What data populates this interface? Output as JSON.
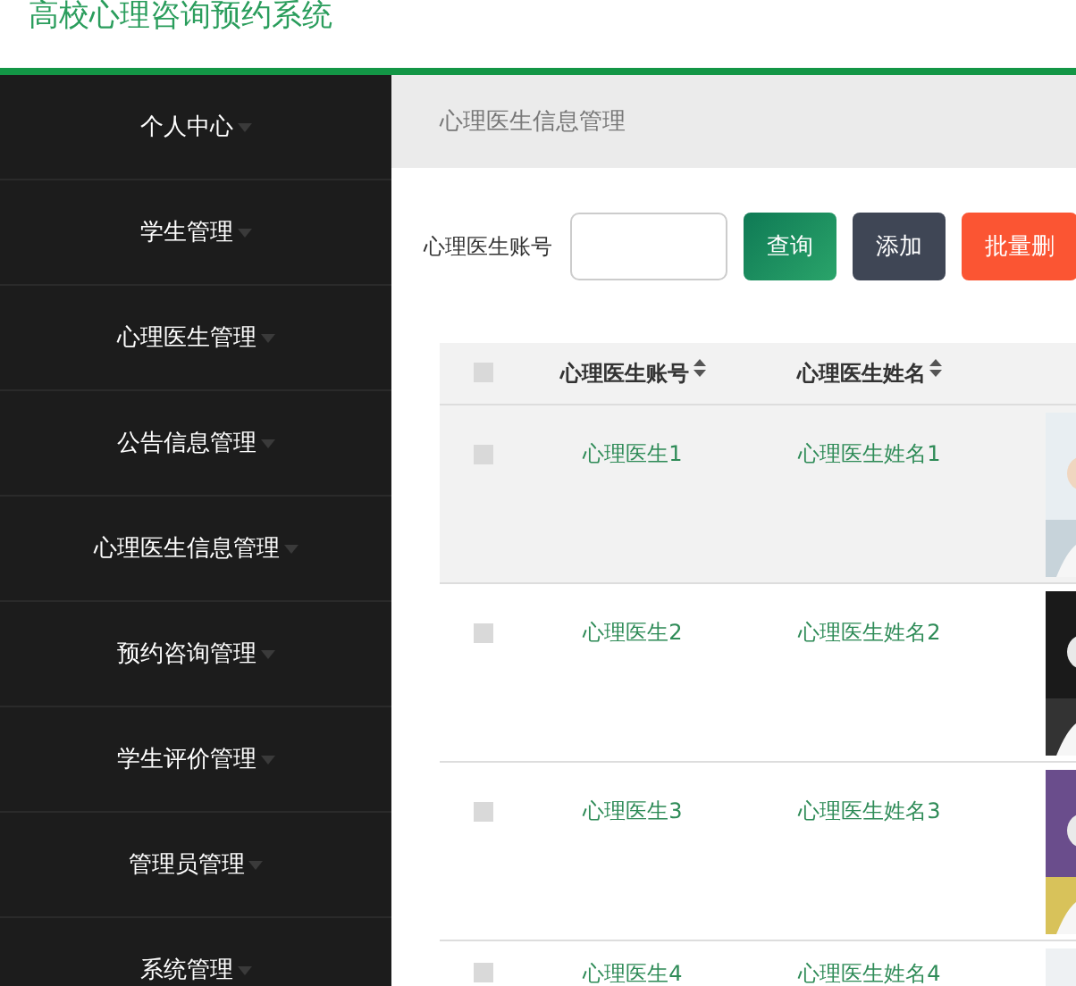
{
  "header": {
    "title": "高校心理咨询预约系统"
  },
  "sidebar": {
    "items": [
      {
        "label": "个人中心"
      },
      {
        "label": "学生管理"
      },
      {
        "label": "心理医生管理"
      },
      {
        "label": "公告信息管理"
      },
      {
        "label": "心理医生信息管理"
      },
      {
        "label": "预约咨询管理"
      },
      {
        "label": "学生评价管理"
      },
      {
        "label": "管理员管理"
      },
      {
        "label": "系统管理"
      }
    ]
  },
  "breadcrumb": "心理医生信息管理",
  "search": {
    "label": "心理医生账号",
    "buttons": [
      {
        "label": "查询",
        "kind": "search"
      },
      {
        "label": "添加",
        "kind": "add"
      },
      {
        "label": "批量删",
        "kind": "delete"
      }
    ]
  },
  "table": {
    "all_checked": false,
    "columns": [
      "心理医生账号",
      "心理医生姓名"
    ],
    "rows": [
      {
        "account": "心理医生1",
        "name": "心理医生姓名1",
        "checked": false,
        "highlighted": true
      },
      {
        "account": "心理医生2",
        "name": "心理医生姓名2",
        "checked": false,
        "highlighted": false
      },
      {
        "account": "心理医生3",
        "name": "心理医生姓名3",
        "checked": false,
        "highlighted": false
      },
      {
        "account": "心理医生4",
        "name": "心理医生姓名4",
        "checked": false,
        "highlighted": false
      }
    ]
  }
}
